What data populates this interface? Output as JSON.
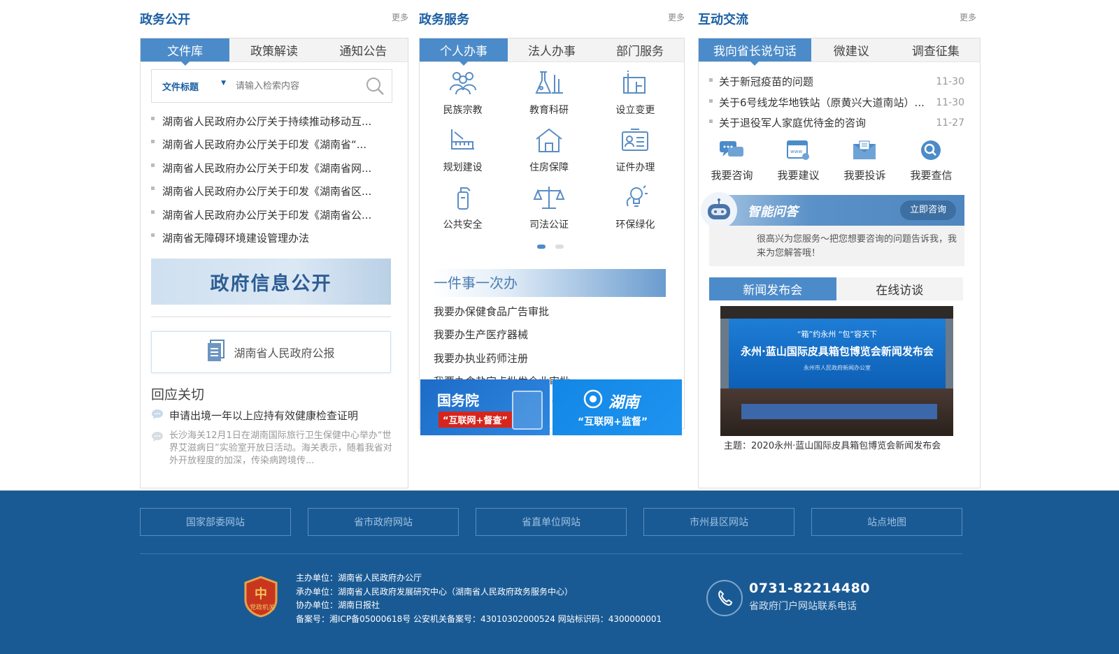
{
  "sections": {
    "gov_open": {
      "title": "政务公开",
      "more": "更多"
    },
    "gov_service": {
      "title": "政务服务",
      "more": "更多"
    },
    "interaction": {
      "title": "互动交流",
      "more": "更多"
    }
  },
  "gov_open": {
    "tabs": [
      "文件库",
      "政策解读",
      "通知公告"
    ],
    "search": {
      "select_label": "文件标题",
      "placeholder": "请输入检索内容"
    },
    "docs": [
      "湖南省人民政府办公厅关于持续推动移动互...",
      "湖南省人民政府办公厅关于印发《湖南省“...",
      "湖南省人民政府办公厅关于印发《湖南省网...",
      "湖南省人民政府办公厅关于印发《湖南省区...",
      "湖南省人民政府办公厅关于印发《湖南省公...",
      "湖南省无障碍环境建设管理办法"
    ],
    "banner": "政府信息公开",
    "gazette": "湖南省人民政府公报",
    "respond_title": "回应关切",
    "respond_question": "申请出境一年以上应持有效健康检查证明",
    "respond_answer": "长沙海关12月1日在湖南国际旅行卫生保健中心举办“世界艾滋病日”实验室开放日活动。海关表示，随着我省对外开放程度的加深，传染病跨境传..."
  },
  "gov_service": {
    "tabs": [
      "个人办事",
      "法人办事",
      "部门服务"
    ],
    "services": [
      {
        "label": "民族宗教",
        "icon": "people-group-icon"
      },
      {
        "label": "教育科研",
        "icon": "lab-flask-icon"
      },
      {
        "label": "设立变更",
        "icon": "building-change-icon"
      },
      {
        "label": "规划建设",
        "icon": "planning-ruler-icon"
      },
      {
        "label": "住房保障",
        "icon": "house-icon"
      },
      {
        "label": "证件办理",
        "icon": "id-card-icon"
      },
      {
        "label": "公共安全",
        "icon": "extinguisher-icon"
      },
      {
        "label": "司法公证",
        "icon": "justice-scale-icon"
      },
      {
        "label": "环保绿化",
        "icon": "eco-bulb-icon"
      }
    ],
    "once_title": "一件事一次办",
    "once_items": [
      "我要办保健食品广告审批",
      "我要办生产医疗器械",
      "我要办执业药师注册",
      "我要办食盐定点批发企业审批"
    ],
    "ad_left": {
      "title": "国务院",
      "sub": "“互联网+督查”"
    },
    "ad_right": {
      "title": "湖南",
      "sub": "“互联网+监督”"
    }
  },
  "interaction": {
    "tabs": [
      "我向省长说句话",
      "微建议",
      "调查征集"
    ],
    "messages": [
      {
        "title": "关于新冠疫苗的问题",
        "date": "11-30"
      },
      {
        "title": "关于6号线龙华地铁站（原黄兴大道南站）...",
        "date": "11-30"
      },
      {
        "title": "关于退役军人家庭优待金的咨询",
        "date": "11-27"
      }
    ],
    "actions": [
      {
        "label": "我要咨询",
        "icon": "chat-icon"
      },
      {
        "label": "我要建议",
        "icon": "web-suggest-icon"
      },
      {
        "label": "我要投诉",
        "icon": "mail-complaint-icon"
      },
      {
        "label": "我要查信",
        "icon": "search-letter-icon"
      }
    ],
    "ai_title": "智能问答",
    "ai_button": "立即咨询",
    "ai_text": "很高兴为您服务～把您想要咨询的问题告诉我，我来为您解答哦！",
    "pub_tabs": [
      "新闻发布会",
      "在线访谈"
    ],
    "photo_banner_top": "“箱”约永州  “包”容天下",
    "photo_banner_main": "永州·蓝山国际皮具箱包博览会新闻发布会",
    "photo_banner_org": "永州市人民政府新闻办公室",
    "caption": "主题：2020永州·蓝山国际皮具箱包博览会新闻发布会"
  },
  "footer": {
    "links": [
      "国家部委网站",
      "省市政府网站",
      "省直单位网站",
      "市州县区网站",
      "站点地图"
    ],
    "host": "主办单位：湖南省人民政府办公厅",
    "undertake": "承办单位：湖南省人民政府发展研究中心（湖南省人民政府政务服务中心）",
    "assist": "协办单位：湖南日报社",
    "record": "备案号：湘ICP备05000618号 公安机关备案号：43010302000524 网站标识码：4300000001",
    "badge": "党政机关",
    "phone": "0731-82214480",
    "phone_desc": "省政府门户网站联系电话"
  },
  "colors": {
    "brand": "#1a5fa3",
    "tab_active": "#4c8bc9",
    "footer_bg": "#1a5a94"
  }
}
